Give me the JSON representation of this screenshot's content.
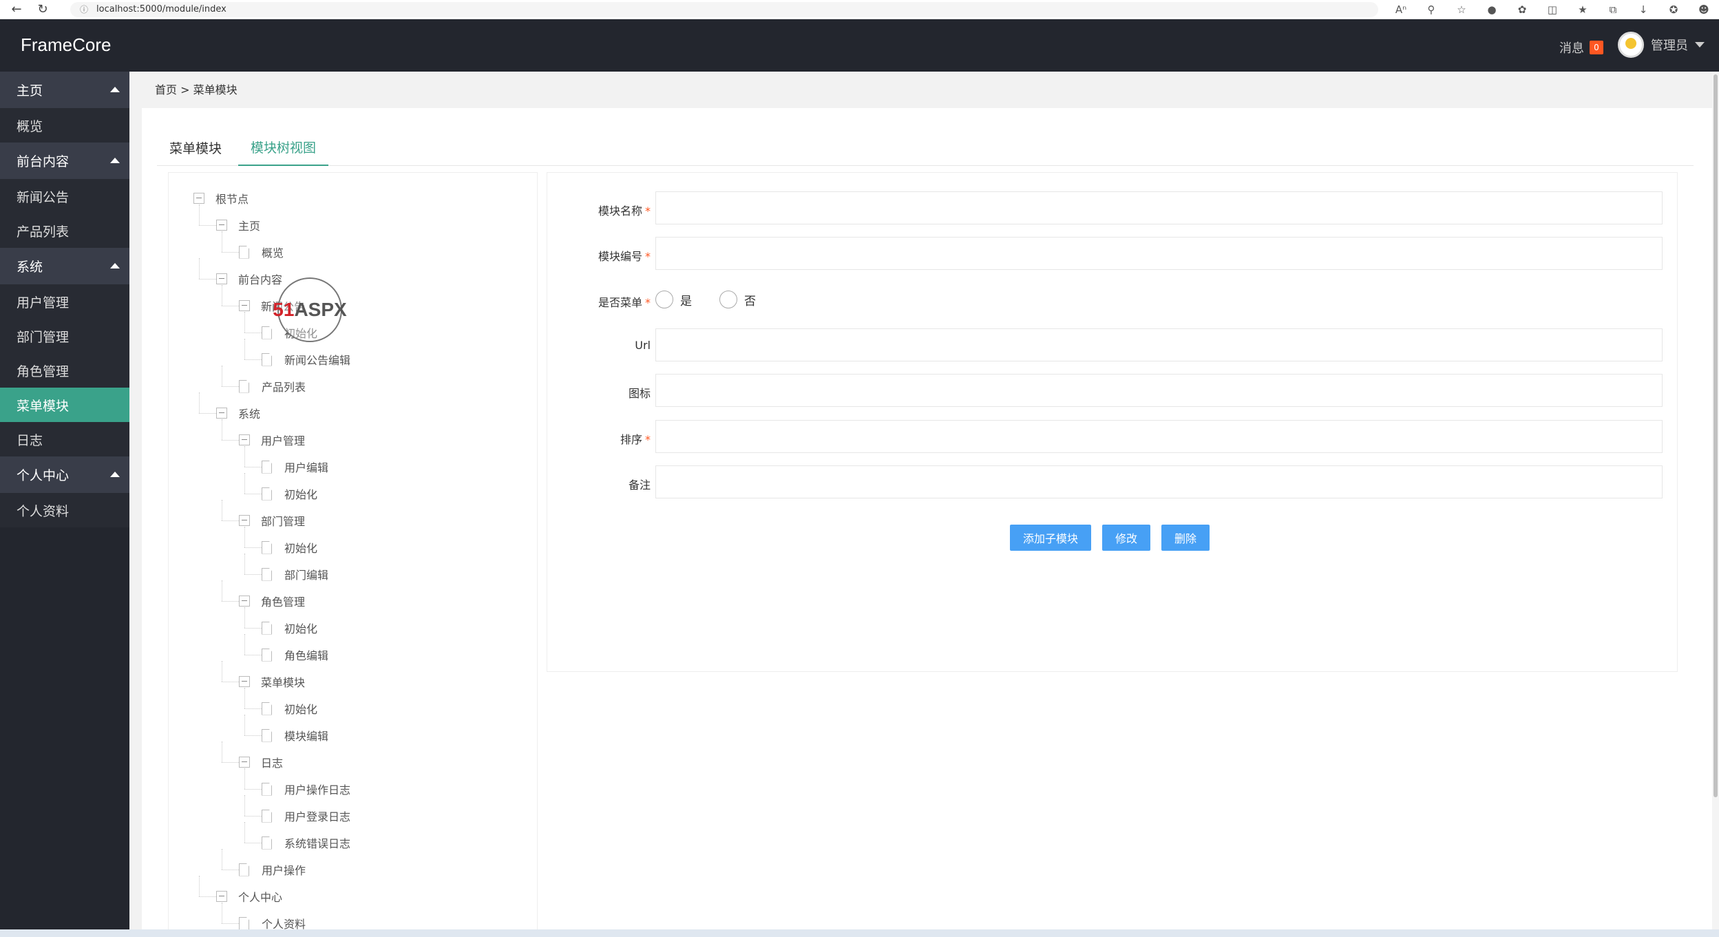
{
  "browser": {
    "url": "localhost:5000/module/index"
  },
  "header": {
    "logo": "FrameCore",
    "messages_label": "消息",
    "messages_count": "0",
    "user_name": "管理员"
  },
  "sidebar": {
    "groups": [
      {
        "label": "主页",
        "items": [
          "概览"
        ]
      },
      {
        "label": "前台内容",
        "items": [
          "新闻公告",
          "产品列表"
        ]
      },
      {
        "label": "系统",
        "items": [
          "用户管理",
          "部门管理",
          "角色管理",
          "菜单模块",
          "日志"
        ]
      },
      {
        "label": "个人中心",
        "items": [
          "个人资料"
        ]
      }
    ],
    "active_item": "菜单模块"
  },
  "breadcrumb": {
    "home": "首页",
    "separator": ">",
    "current": "菜单模块"
  },
  "tabs": [
    {
      "label": "菜单模块",
      "active": false
    },
    {
      "label": "模块树视图",
      "active": true
    }
  ],
  "tree": {
    "root": "根节点",
    "nodes": [
      {
        "label": "主页",
        "type": "folder"
      },
      {
        "label": "概览",
        "type": "leaf"
      },
      {
        "label": "前台内容",
        "type": "folder"
      },
      {
        "label": "新闻公告",
        "type": "folder"
      },
      {
        "label": "初始化",
        "type": "leaf"
      },
      {
        "label": "新闻公告编辑",
        "type": "leaf"
      },
      {
        "label": "产品列表",
        "type": "leaf"
      },
      {
        "label": "系统",
        "type": "folder"
      },
      {
        "label": "用户管理",
        "type": "folder"
      },
      {
        "label": "用户编辑",
        "type": "leaf"
      },
      {
        "label": "初始化",
        "type": "leaf"
      },
      {
        "label": "部门管理",
        "type": "folder"
      },
      {
        "label": "初始化",
        "type": "leaf"
      },
      {
        "label": "部门编辑",
        "type": "leaf"
      },
      {
        "label": "角色管理",
        "type": "folder"
      },
      {
        "label": "初始化",
        "type": "leaf"
      },
      {
        "label": "角色编辑",
        "type": "leaf"
      },
      {
        "label": "菜单模块",
        "type": "folder"
      },
      {
        "label": "初始化",
        "type": "leaf"
      },
      {
        "label": "模块编辑",
        "type": "leaf"
      },
      {
        "label": "日志",
        "type": "folder"
      },
      {
        "label": "用户操作日志",
        "type": "leaf"
      },
      {
        "label": "用户登录日志",
        "type": "leaf"
      },
      {
        "label": "系统错误日志",
        "type": "leaf"
      },
      {
        "label": "用户操作",
        "type": "leaf"
      },
      {
        "label": "个人中心",
        "type": "folder"
      },
      {
        "label": "个人资料",
        "type": "leaf"
      }
    ]
  },
  "form": {
    "module_name_label": "模块名称",
    "module_code_label": "模块编号",
    "is_menu_label": "是否菜单",
    "is_menu_yes": "是",
    "is_menu_no": "否",
    "url_label": "Url",
    "icon_label": "图标",
    "sort_label": "排序",
    "remark_label": "备注",
    "required_mark": "*",
    "module_name_value": "",
    "module_code_value": "",
    "url_value": "",
    "icon_value": "",
    "sort_value": "",
    "remark_value": ""
  },
  "buttons": {
    "add_child": "添加子模块",
    "edit": "修改",
    "delete": "删除"
  },
  "watermark": {
    "text_red": "51",
    "text_dark": "ASPX"
  },
  "colors": {
    "header_bg": "#23262e",
    "accent": "#3aa28a",
    "button": "#47a0f5",
    "badge": "#ff5722"
  }
}
